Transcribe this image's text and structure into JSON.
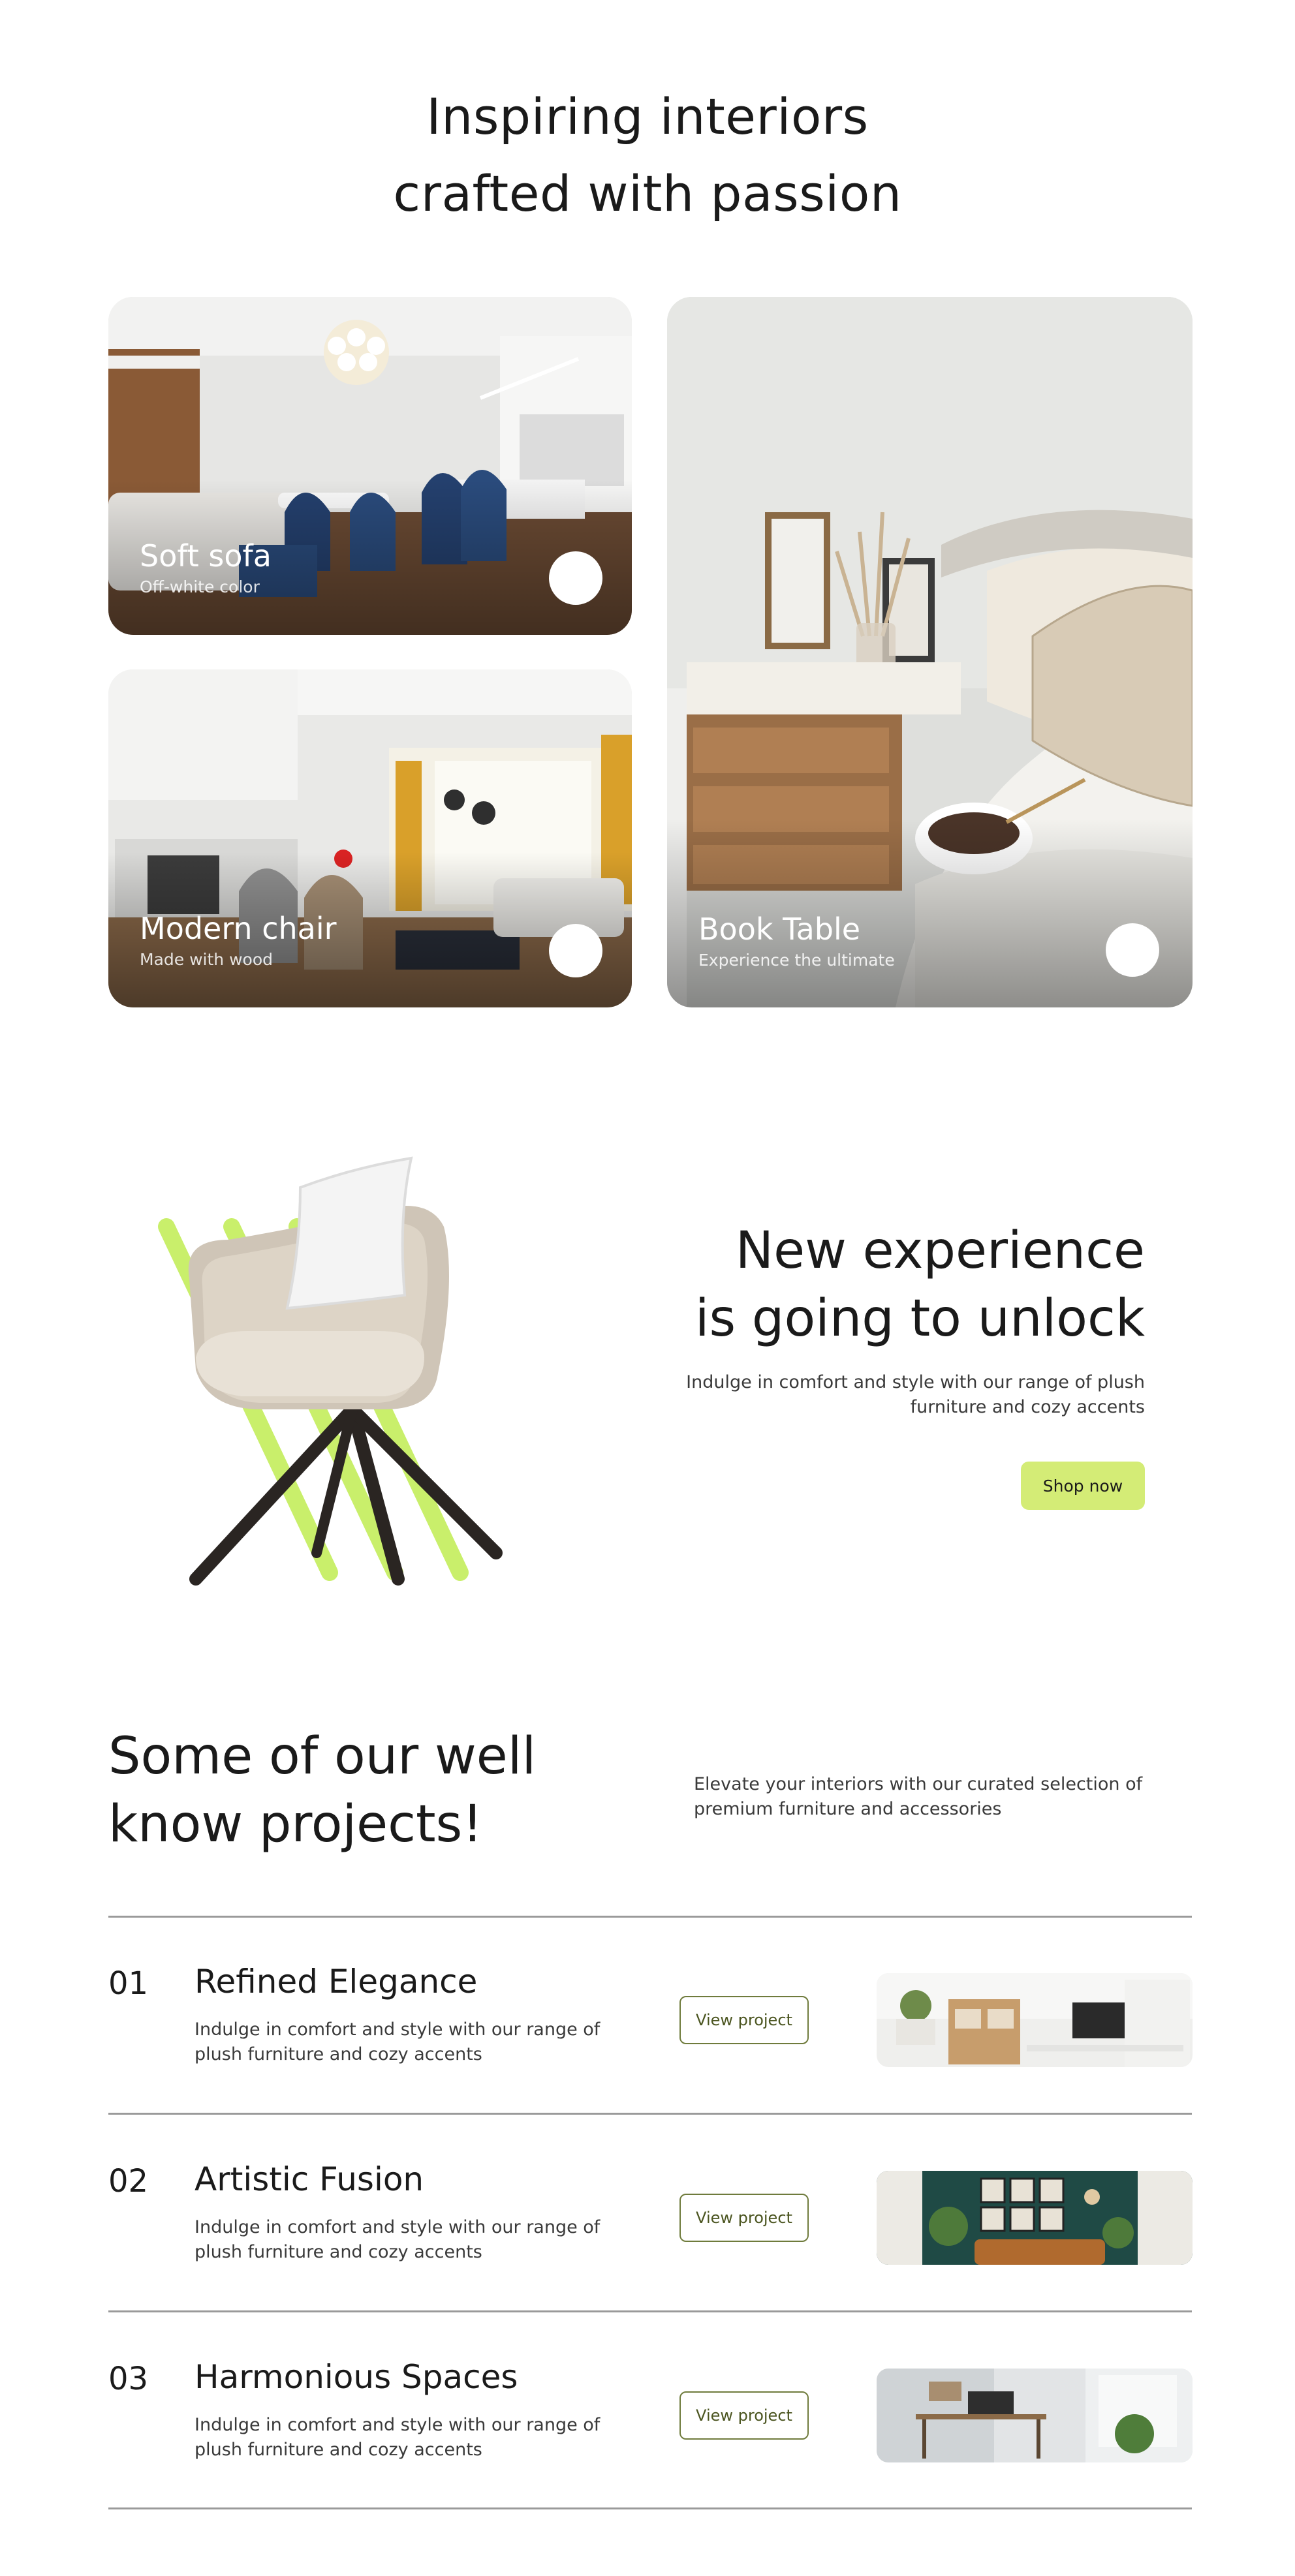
{
  "hero": {
    "title_line1": "Inspiring interiors",
    "title_line2": "crafted with passion"
  },
  "cards": [
    {
      "title": "Soft sofa",
      "subtitle": "Off-white color"
    },
    {
      "title": "Modern chair",
      "subtitle": "Made with wood"
    },
    {
      "title": "Book Table",
      "subtitle": "Experience the ultimate"
    }
  ],
  "promo": {
    "title_line1": "New experience",
    "title_line2": "is going to unlock",
    "text": "Indulge in comfort and style with our range of plush furniture and cozy accents",
    "button": "Shop now",
    "accent_color": "#d4ec76"
  },
  "projects": {
    "heading_line1": "Some of our well",
    "heading_line2": "know projects!",
    "intro": "Elevate your interiors with our curated selection of premium furniture and accessories",
    "items": [
      {
        "number": "01",
        "title": "Refined Elegance",
        "desc": "Indulge in comfort and style with our range of plush furniture and cozy accents",
        "button": "View project"
      },
      {
        "number": "02",
        "title": "Artistic Fusion",
        "desc": "Indulge in comfort and style with our range of plush furniture and cozy accents",
        "button": "View project"
      },
      {
        "number": "03",
        "title": "Harmonious Spaces",
        "desc": "Indulge in comfort and style with our range of plush furniture and cozy accents",
        "button": "View project"
      }
    ]
  }
}
